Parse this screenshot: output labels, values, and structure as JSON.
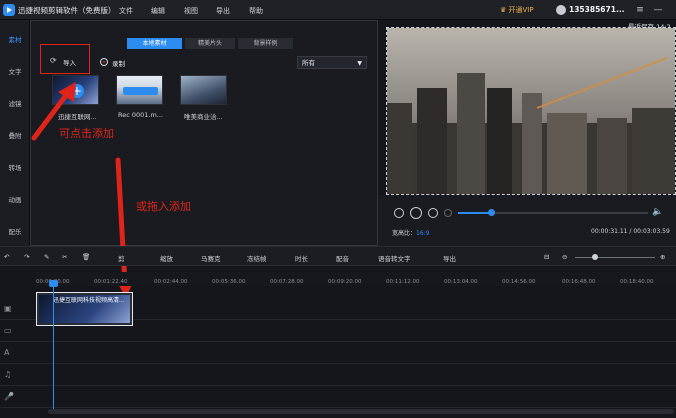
{
  "app": {
    "title": "迅捷视频剪辑软件（免费版）",
    "menu": [
      "文件",
      "编辑",
      "视图",
      "导出",
      "帮助"
    ],
    "vip": "开通VIP",
    "user": "135385671...",
    "save_status": "最近保存 14:2"
  },
  "sidebar": {
    "items": [
      "素材",
      "文字",
      "滤镜",
      "叠附",
      "转场",
      "动画",
      "配乐"
    ]
  },
  "media": {
    "tabs": [
      "本地素材",
      "精美片头",
      "背景样例"
    ],
    "import_label": "导入",
    "record_label": "录制",
    "filter": "所有",
    "items": [
      "迅捷互联网...",
      "Rec 0001.m...",
      "唯美商业洽..."
    ]
  },
  "annotations": {
    "click_add": "可点击添加",
    "drag_add": "或拖入添加"
  },
  "player": {
    "ratio_label": "宽高比：",
    "ratio": "16:9",
    "time": "00:00:31.11 / 00:03:03.59"
  },
  "toolbar": {
    "items": [
      "剪",
      "缩放",
      "马赛克",
      "冻结帧",
      "时长",
      "配音",
      "语音转文字",
      "导出"
    ]
  },
  "timeline": {
    "ticks": [
      "00:00:00.00",
      "00:01:22.40",
      "00:02:44.00",
      "00:05:36.00",
      "00:07:28.00",
      "00:09:20.00",
      "00:11:12.00",
      "00:13:04.00",
      "00:14:56.00",
      "00:16:48.00",
      "00:18:40.00"
    ],
    "clip_label": "迅捷互联网科技视频高清..."
  },
  "colors": {
    "accent": "#2d8cf0",
    "annotation": "#e0241a",
    "vip": "#f0b04a"
  }
}
